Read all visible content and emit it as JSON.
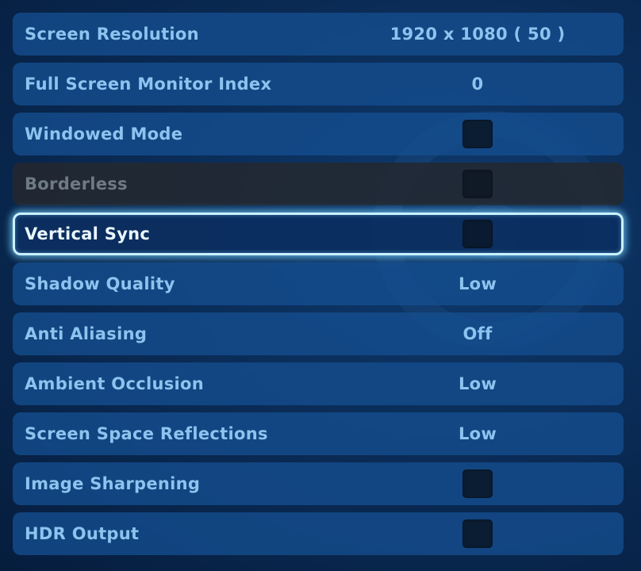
{
  "settings": {
    "rows": [
      {
        "label": "Screen Resolution",
        "value": "1920 x 1080 ( 50 )"
      },
      {
        "label": "Full Screen Monitor Index",
        "value": "0"
      },
      {
        "label": "Windowed Mode",
        "checked": false
      },
      {
        "label": "Borderless",
        "checked": false,
        "disabled": true
      },
      {
        "label": "Vertical Sync",
        "checked": false,
        "selected": true
      },
      {
        "label": "Shadow Quality",
        "value": "Low"
      },
      {
        "label": "Anti Aliasing",
        "value": "Off"
      },
      {
        "label": "Ambient Occlusion",
        "value": "Low"
      },
      {
        "label": "Screen Space Reflections",
        "value": "Low"
      },
      {
        "label": "Image Sharpening",
        "checked": false
      },
      {
        "label": "HDR Output",
        "checked": false
      }
    ]
  },
  "colors": {
    "row_background": "#154e8f",
    "label_text": "#8cc4ef",
    "selected_border": "#c9f1ff",
    "disabled_background": "#23282f"
  }
}
